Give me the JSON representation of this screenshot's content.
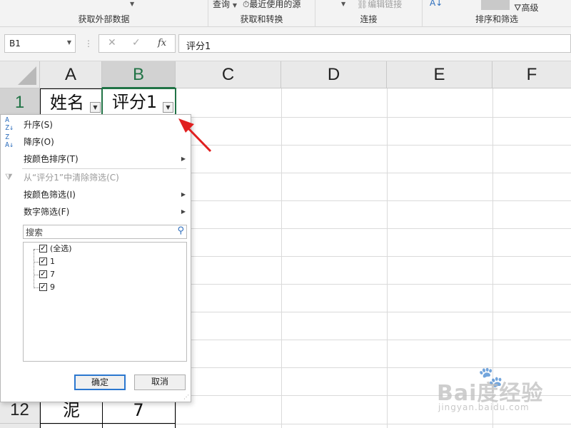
{
  "ribbon": {
    "groups": [
      {
        "label": "获取外部数据"
      },
      {
        "label": "获取和转换"
      },
      {
        "label": "连接"
      },
      {
        "label": "排序和筛选"
      }
    ],
    "query_label": "查询",
    "recent_sources_label": "最近使用的源",
    "edit_links_label": "编辑链接",
    "advanced_label": "高级"
  },
  "formula_bar": {
    "name_box": "B1",
    "value": "评分1"
  },
  "grid": {
    "columns": [
      "A",
      "B",
      "C",
      "D",
      "E",
      "F"
    ],
    "rows": [
      {
        "num": "1",
        "a": "姓名",
        "b": "评分1"
      },
      {
        "num": "12",
        "a": "泥",
        "b": "7"
      }
    ]
  },
  "filter_menu": {
    "sort_asc": "升序(S)",
    "sort_desc": "降序(O)",
    "sort_by_color": "按颜色排序(T)",
    "clear_filter": "从“评分1”中清除筛选(C)",
    "filter_by_color": "按颜色筛选(I)",
    "number_filter": "数字筛选(F)",
    "search_placeholder": "搜索",
    "items": [
      {
        "label": "(全选)",
        "checked": true
      },
      {
        "label": "1",
        "checked": true
      },
      {
        "label": "7",
        "checked": true
      },
      {
        "label": "9",
        "checked": true
      }
    ],
    "ok_label": "确定",
    "cancel_label": "取消"
  },
  "watermark": {
    "brand": "Bai度经验",
    "url": "jingyan.baidu.com"
  },
  "colors": {
    "excel_green": "#217346",
    "annotation_red": "#e02020",
    "focus_blue": "#2b77cf"
  }
}
